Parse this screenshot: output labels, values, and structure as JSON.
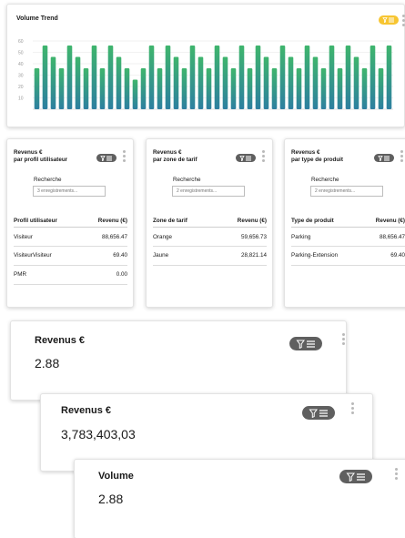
{
  "volume_trend": {
    "title": "Volume Trend",
    "filter_color": "#f7c531",
    "chart_data": {
      "type": "bar",
      "title": "",
      "xlabel": "",
      "ylabel": "",
      "yticks": [
        "60",
        "50",
        "40",
        "30",
        "20",
        "10"
      ],
      "ylim": [
        0,
        60
      ],
      "grid": true,
      "legend": "none",
      "gradient_top": "#3fb56d",
      "gradient_bottom": "#2d7fa0",
      "values": [
        36,
        56,
        46,
        36,
        56,
        46,
        36,
        56,
        36,
        56,
        46,
        36,
        26,
        36,
        56,
        36,
        56,
        46,
        36,
        56,
        46,
        36,
        56,
        46,
        36,
        56,
        36,
        56,
        46,
        36,
        56,
        46,
        36,
        56,
        46,
        36,
        56,
        36,
        56,
        46,
        36,
        56,
        36,
        56
      ]
    }
  },
  "table_cards": [
    {
      "title_line1": "Revenus €",
      "title_line2": "par profil utilisateur",
      "search_label": "Recherche",
      "search_placeholder": "3 enregistrements...",
      "columns": [
        "Profil utilisateur",
        "Revenu (€)"
      ],
      "rows": [
        [
          "Visiteur",
          "88,656.47"
        ],
        [
          "VisiteurVisiteur",
          "69.40"
        ],
        [
          "PMR",
          "0.00"
        ]
      ]
    },
    {
      "title_line1": "Revenus €",
      "title_line2": "par zone de tarif",
      "search_label": "Recherche",
      "search_placeholder": "2 enregistrements...",
      "columns": [
        "Zone de tarif",
        "Revenu (€)"
      ],
      "rows": [
        [
          "Orange",
          "59,656.73"
        ],
        [
          "Jaune",
          "28,821.14"
        ]
      ]
    },
    {
      "title_line1": "Revenus €",
      "title_line2": "par type de produit",
      "search_label": "Recherche",
      "search_placeholder": "2 enregistrements...",
      "columns": [
        "Type de produit",
        "Revenu (€)"
      ],
      "rows": [
        [
          "Parking",
          "88,656.47"
        ],
        [
          "Parking-Extension",
          "69.40"
        ]
      ]
    }
  ],
  "kpi_cards": [
    {
      "title": "Revenus €",
      "value": "2.88"
    },
    {
      "title": "Revenus €",
      "value": "3,783,403,03"
    },
    {
      "title": "Volume",
      "value": "2.88"
    }
  ],
  "filter_icon": "filter-list-icon",
  "menu_icon": "kebab-menu-icon"
}
